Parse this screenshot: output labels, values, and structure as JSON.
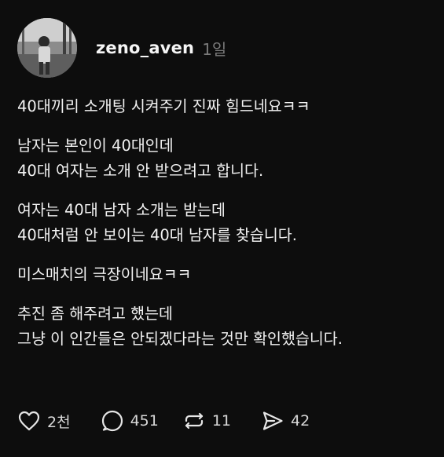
{
  "post": {
    "username": "zeno_aven",
    "time": "1일",
    "paragraphs": [
      [
        "40대끼리 소개팅 시켜주기 진짜 힘드네요ㅋㅋ"
      ],
      [
        "남자는 본인이 40대인데",
        "40대 여자는 소개 안 받으려고 합니다."
      ],
      [
        "여자는 40대 남자 소개는 받는데",
        "40대처럼 안 보이는 40대 남자를 찾습니다."
      ],
      [
        "미스매치의 극장이네요ㅋㅋ"
      ],
      [
        "추진 좀 해주려고 했는데",
        "그냥 이 인간들은 안되겠다라는 것만 확인했습니다."
      ]
    ],
    "actions": {
      "like": {
        "icon": "heart-icon",
        "count": "2천"
      },
      "comment": {
        "icon": "comment-icon",
        "count": "451"
      },
      "repost": {
        "icon": "repost-icon",
        "count": "11"
      },
      "share": {
        "icon": "send-icon",
        "count": "42"
      }
    }
  },
  "colors": {
    "background": "#0d0d0d",
    "text": "#f2f2f2",
    "muted": "#7a7a7a"
  }
}
